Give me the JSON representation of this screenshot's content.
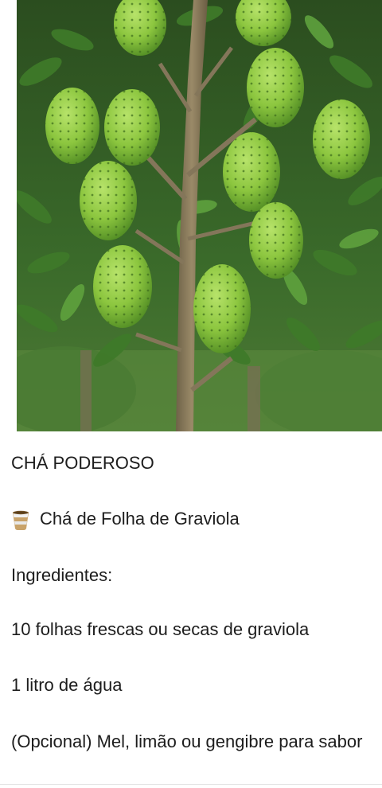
{
  "photo": {
    "subject_icon": "soursop-tree-photo"
  },
  "post": {
    "title": "CHÁ PODEROSO",
    "tea_icon": "tea-cup-icon",
    "tea_name": "Chá de Folha de Graviola",
    "ingredients_heading": "Ingredientes:",
    "ingredients": [
      "10 folhas frescas ou secas de graviola",
      "1 litro de água",
      "(Opcional) Mel, limão ou gengibre para sabor"
    ]
  },
  "colors": {
    "leaf_dark": "#2f5a22",
    "leaf_light": "#5d9a3a",
    "fruit": "#8cc63f",
    "trunk": "#8a7a5c",
    "text": "#1d1d1d"
  }
}
